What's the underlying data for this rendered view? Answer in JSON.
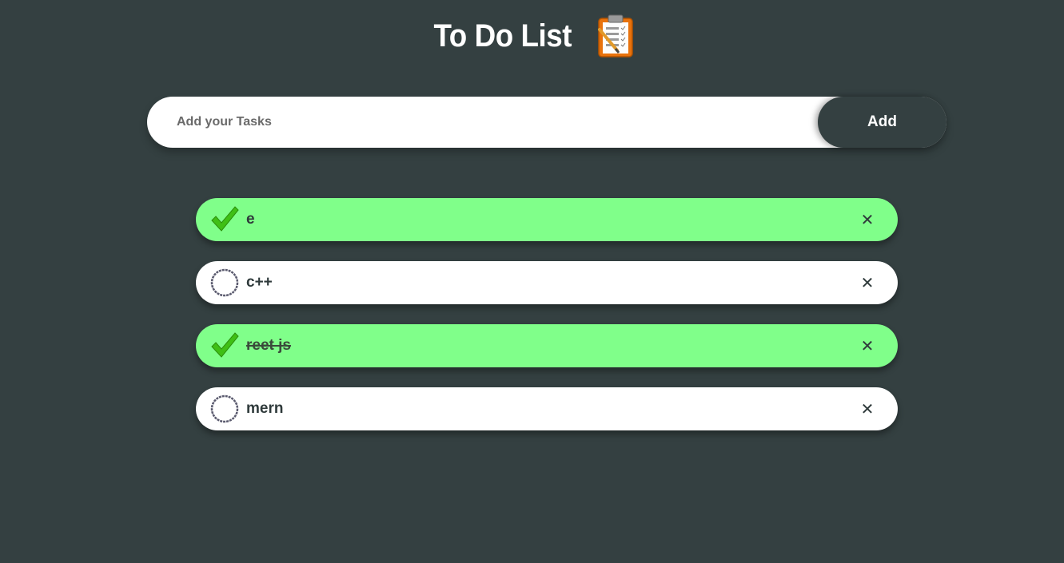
{
  "header": {
    "title": "To Do List",
    "icon": "clipboard-checklist-icon"
  },
  "input": {
    "placeholder": "Add your Tasks",
    "value": ""
  },
  "add_button": {
    "label": "Add"
  },
  "tasks": [
    {
      "text": "e",
      "checked": true,
      "struck": false,
      "delete_label": "✕"
    },
    {
      "text": "c++",
      "checked": false,
      "struck": false,
      "delete_label": "✕"
    },
    {
      "text": "reet js",
      "checked": true,
      "struck": true,
      "delete_label": "✕"
    },
    {
      "text": "mern",
      "checked": false,
      "struck": false,
      "delete_label": "✕"
    }
  ],
  "colors": {
    "background": "#344041",
    "checked_row": "#80ff8a",
    "unchecked_row": "#ffffff",
    "check_green": "#3fbf15",
    "add_button": "#344041"
  }
}
